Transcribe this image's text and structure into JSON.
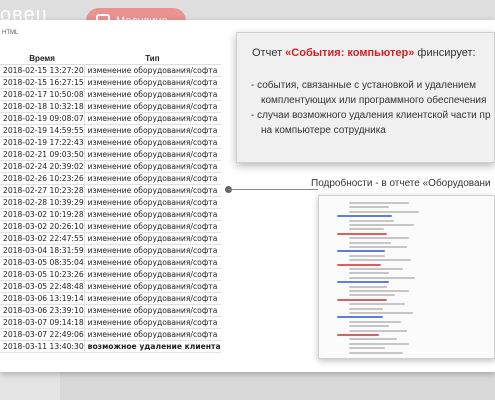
{
  "header": {
    "title_fragment": "овец",
    "pill_label": "Модулине"
  },
  "slide": {
    "html_label": "HTML",
    "table": {
      "columns": [
        "Время",
        "Тип"
      ],
      "rows": [
        [
          "2018-02-15 13:27:20",
          "изменение оборудования/софта"
        ],
        [
          "2018-02-15 16:27:15",
          "изменение оборудования/софта"
        ],
        [
          "2018-02-17 10:50:08",
          "изменение оборудования/софта"
        ],
        [
          "2018-02-18 10:32:18",
          "изменение оборудования/софта"
        ],
        [
          "2018-02-19 09:08:07",
          "изменение оборудования/софта"
        ],
        [
          "2018-02-19 14:59:55",
          "изменение оборудования/софта"
        ],
        [
          "2018-02-19 17:22:43",
          "изменение оборудования/софта"
        ],
        [
          "2018-02-21 09:03:50",
          "изменение оборудования/софта"
        ],
        [
          "2018-02-24 20:39:02",
          "изменение оборудования/софта"
        ],
        [
          "2018-02-26 10:23:26",
          "изменение оборудования/софта"
        ],
        [
          "2018-02-27 10:23:28",
          "изменение оборудования/софта"
        ],
        [
          "2018-02-28 10:39:29",
          "изменение оборудования/софта"
        ],
        [
          "2018-03-02 10:19:28",
          "изменение оборудования/софта"
        ],
        [
          "2018-03-02 20:26:10",
          "изменение оборудования/софта"
        ],
        [
          "2018-03-02 22:47:55",
          "изменение оборудования/софта"
        ],
        [
          "2018-03-04 18:31:59",
          "изменение оборудования/софта"
        ],
        [
          "2018-03-05 08:35:04",
          "изменение оборудования/софта"
        ],
        [
          "2018-03-05 10:23:26",
          "изменение оборудования/софта"
        ],
        [
          "2018-03-05 22:48:48",
          "изменение оборудования/софта"
        ],
        [
          "2018-03-06 13:19:14",
          "изменение оборудования/софта"
        ],
        [
          "2018-03-06 23:39:10",
          "изменение оборудования/софта"
        ],
        [
          "2018-03-07 09:14:18",
          "изменение оборудования/софта"
        ],
        [
          "2018-03-07 22:49:06",
          "изменение оборудования/софта"
        ],
        [
          "2018-03-11 13:40:30",
          "возможное удаление клиента"
        ]
      ],
      "bold_row_index": 23
    },
    "note": {
      "title_prefix": "Отчет ",
      "title_highlight": "«События: компьютер»",
      "title_suffix": " финсирует:",
      "lines": [
        "- события, связанные с установкой и удалением",
        "комплентующих или программного обеспечения",
        "- случаи возможного удаления клиентской части пр",
        "на компьютере сотрудника"
      ]
    },
    "details_label": "Подробности - в отчете «Оборудовани"
  },
  "colors": {
    "highlight": "#d21f26",
    "thumb_blue": "#3a5fd0",
    "thumb_red": "#d23b3b",
    "thumb_gray": "#9a9a9a"
  }
}
